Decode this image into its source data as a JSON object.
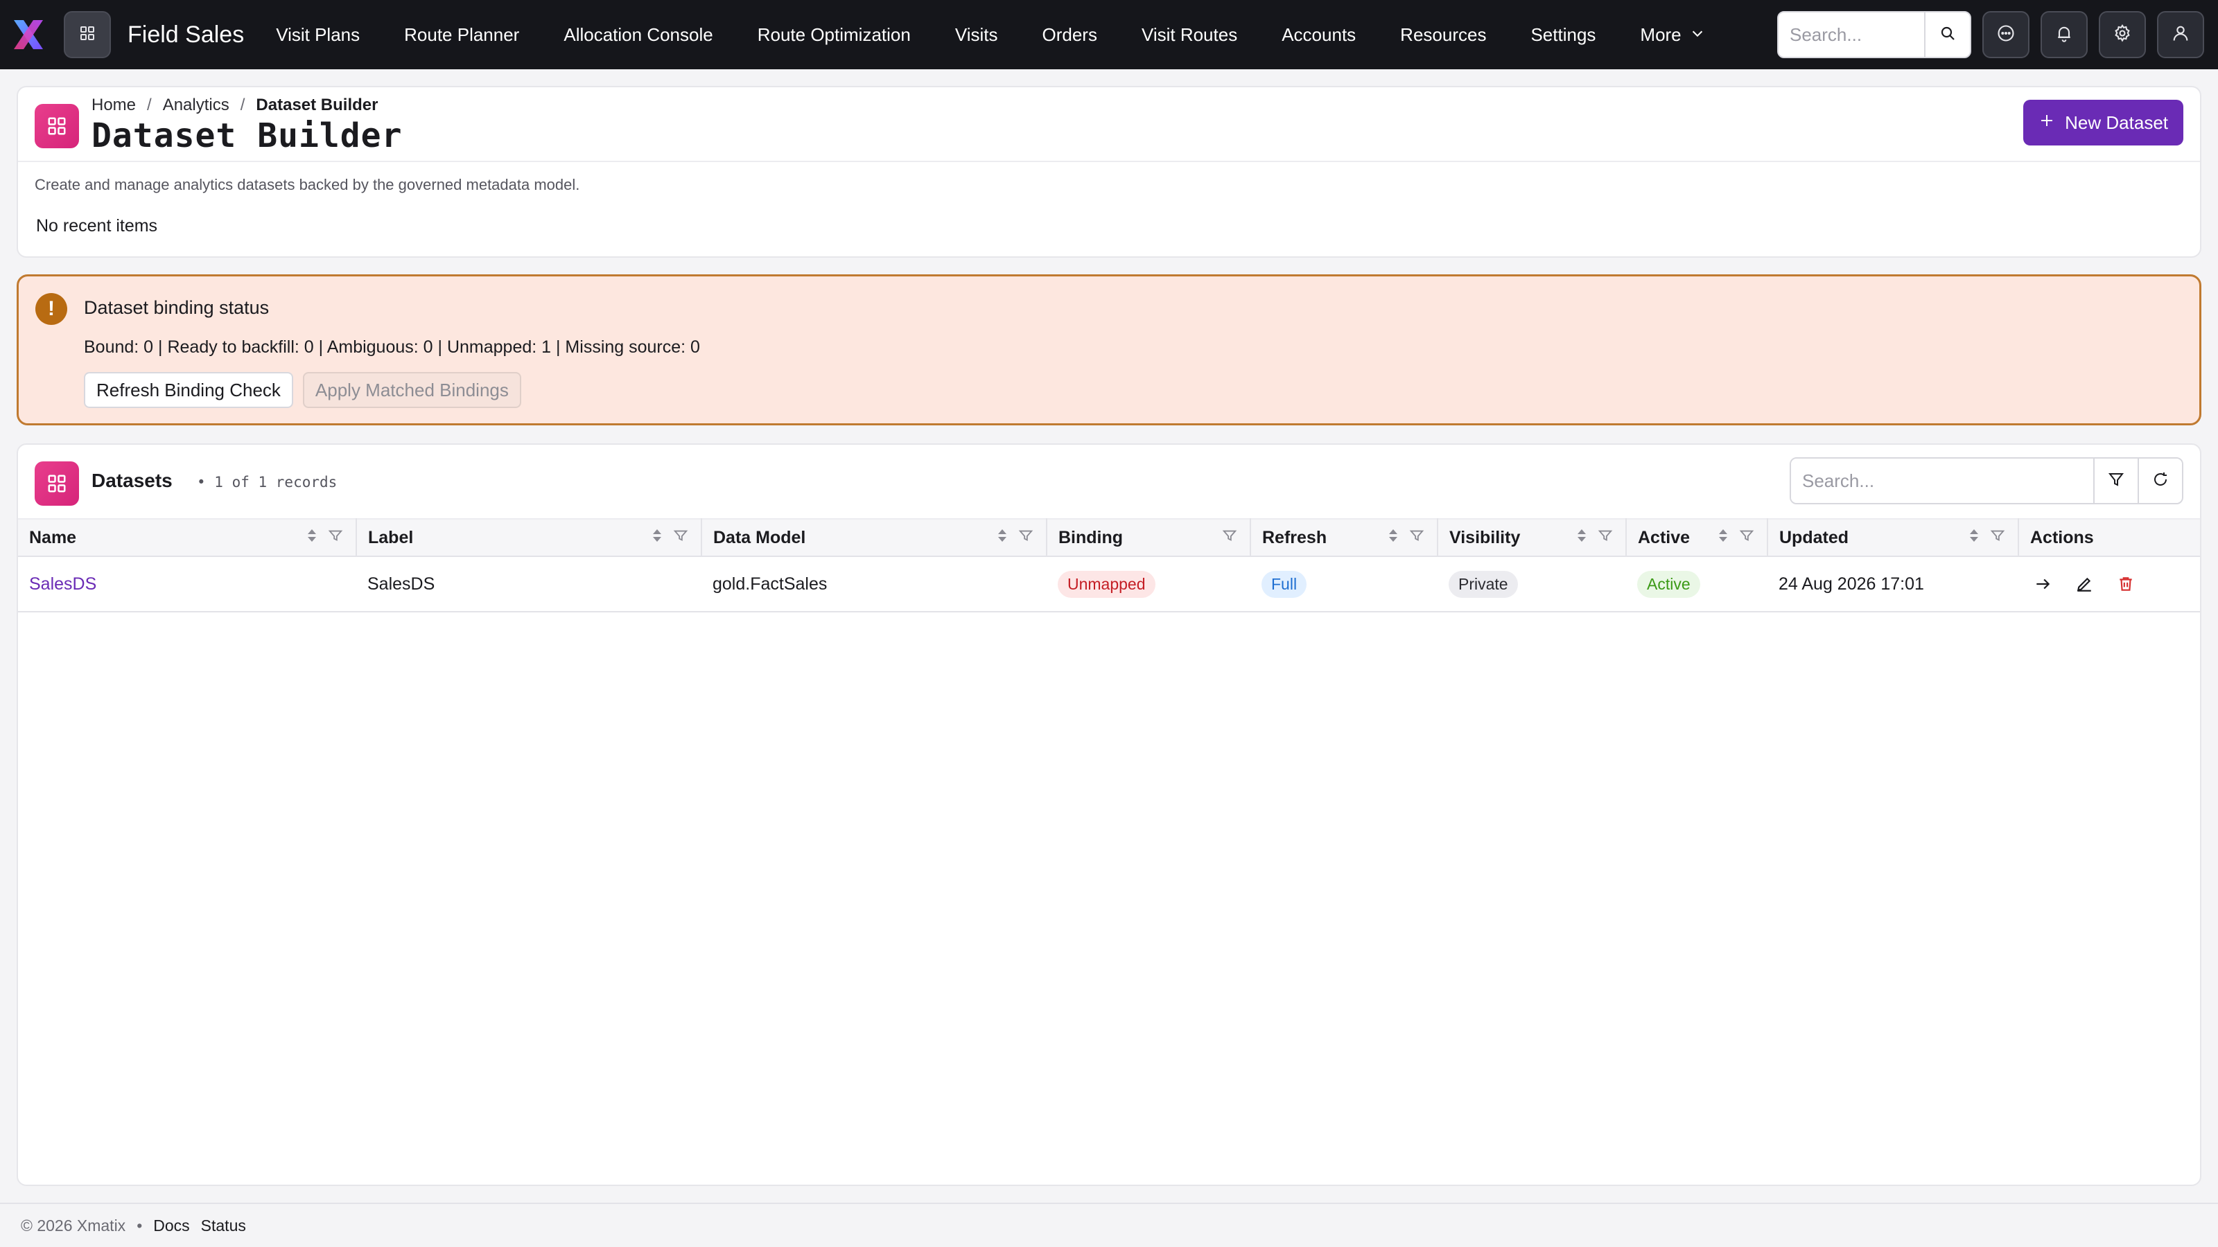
{
  "app": {
    "brand": "Field Sales"
  },
  "nav": {
    "items": [
      "Visit Plans",
      "Route Planner",
      "Allocation Console",
      "Route Optimization",
      "Visits",
      "Orders",
      "Visit Routes",
      "Accounts",
      "Resources",
      "Settings"
    ],
    "more_label": "More",
    "search_placeholder": "Search..."
  },
  "header": {
    "breadcrumb": {
      "home": "Home",
      "section": "Analytics",
      "current": "Dataset Builder",
      "separator": "/"
    },
    "title": "Dataset Builder",
    "new_button": "New Dataset",
    "description": "Create and manage analytics datasets backed by the governed metadata model.",
    "recent": "No recent items"
  },
  "alert": {
    "icon": "!",
    "title": "Dataset binding status",
    "text": "Bound: 0 | Ready to backfill: 0 | Ambiguous: 0 | Unmapped: 1 | Missing source: 0",
    "refresh_button": "Refresh Binding Check",
    "apply_button": "Apply Matched Bindings"
  },
  "datasets": {
    "title": "Datasets",
    "count": "• 1 of 1 records",
    "search_placeholder": "Search...",
    "columns": [
      "Name",
      "Label",
      "Data Model",
      "Binding",
      "Refresh",
      "Visibility",
      "Active",
      "Updated",
      "Actions"
    ],
    "rows": [
      {
        "name": "SalesDS",
        "label": "SalesDS",
        "data_model": "gold.FactSales",
        "binding": "Unmapped",
        "refresh": "Full",
        "visibility": "Private",
        "active": "Active",
        "updated": "24 Aug 2026 17:01"
      }
    ]
  },
  "footer": {
    "copyright": "© 2026 Xmatix",
    "separator": "•",
    "docs": "Docs",
    "status": "Status"
  },
  "colors": {
    "nav_bg": "#15161b",
    "accent": "#6a2bb5",
    "page_icon": "#e83e8c",
    "alert_bg": "#fde7df",
    "alert_border": "#c07a30"
  }
}
